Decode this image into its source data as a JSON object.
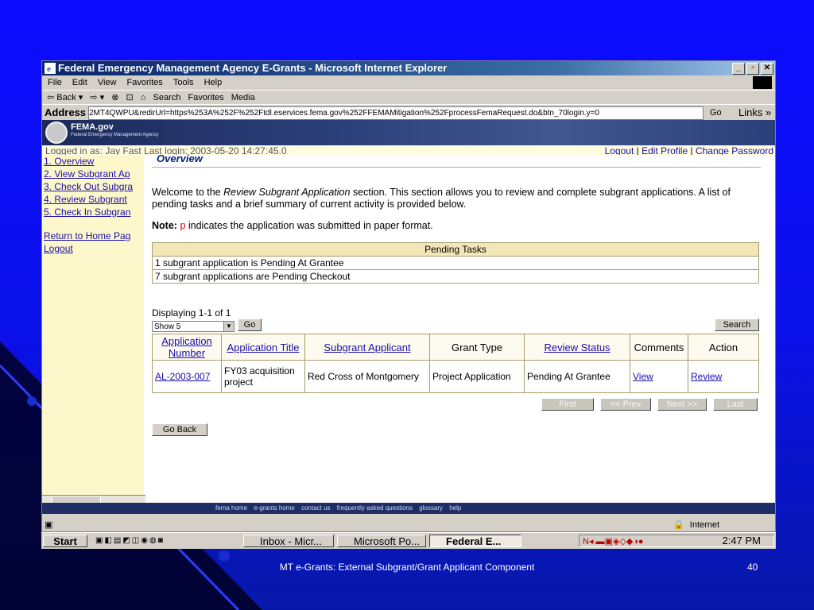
{
  "window": {
    "title": "Federal Emergency Management Agency E-Grants - Microsoft Internet Explorer",
    "menu": [
      "File",
      "Edit",
      "View",
      "Favorites",
      "Tools",
      "Help"
    ],
    "toolbar": [
      "⇦ Back ▾",
      "⇨ ▾",
      "⊗",
      "⊡",
      "⌂",
      "Search",
      "Favorites",
      "Media"
    ],
    "address_label": "Address",
    "address": "2MT4QWPU&redirUrl=https%253A%252F%252Ftdl.eservices.fema.gov%252FFEMAMitigation%252FprocessFemaRequest.do&btn_70login.y=0",
    "go_label": "Go",
    "links_label": "Links »"
  },
  "banner": {
    "logo": "FEMA.gov",
    "subtitle": "Federal Emergency Management Agency"
  },
  "login": {
    "text": "Logged in as: Jay Fast Last login: 2003-05-20 14:27:45.0",
    "logout": "Logout",
    "edit_profile": "Edit Profile",
    "change_password": "Change Password"
  },
  "sidebar": {
    "items": [
      "1. Overview",
      "2. View Subgrant Ap",
      "3. Check Out Subgra",
      "4. Review Subgrant",
      "5. Check In Subgran"
    ],
    "home": "Return to Home Pag",
    "logout": "Logout"
  },
  "main": {
    "section_title": "Overview",
    "welcome_before": "Welcome to the ",
    "welcome_em": "Review Subgrant Application",
    "welcome_after": " section. This section allows you to review and complete subgrant applications. A list of pending tasks and a brief summary of current activity is provided below.",
    "note_label": "Note:",
    "note_p": "p",
    "note_text": " indicates the application was submitted in paper format.",
    "pending_header": "Pending Tasks",
    "pending_rows": [
      "1 subgrant application is Pending At Grantee",
      "7 subgrant applications are Pending Checkout"
    ],
    "displaying": "Displaying 1-1 of 1",
    "show_value": "Show 5",
    "go_button": "Go",
    "search_button": "Search",
    "columns": [
      "Application Number",
      "Application Title",
      "Subgrant Applicant",
      "Grant Type",
      "Review Status",
      "Comments",
      "Action"
    ],
    "row": {
      "number": "AL-2003-007",
      "title": "FY03 acquisition project",
      "applicant": "Red Cross of Montgomery",
      "grant_type": "Project Application",
      "status": "Pending At Grantee",
      "comments": "View",
      "action": "Review"
    },
    "pager": [
      "First",
      "<< Prev",
      "Next >>",
      "Last"
    ],
    "go_back": "Go Back"
  },
  "footer_nav": [
    "fema home",
    "e-grants home",
    "contact us",
    "frequently asked questions",
    "glossary",
    "help"
  ],
  "statusbar": {
    "zone": "Internet"
  },
  "taskbar": {
    "start": "Start",
    "tasks": [
      "Inbox - Micr...",
      "Microsoft Po...",
      "Federal E..."
    ],
    "clock": "2:47 PM"
  },
  "slide": {
    "footer": "MT e-Grants: External Subgrant/Grant Applicant Component",
    "page_number": "40"
  }
}
